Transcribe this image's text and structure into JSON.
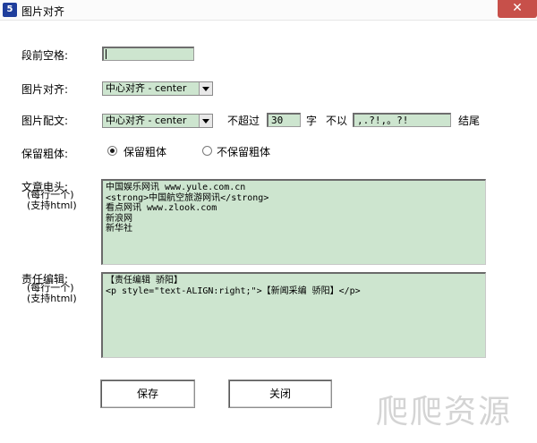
{
  "window": {
    "icon_text": "5",
    "title": "图片对齐",
    "close_glyph": "✕"
  },
  "form": {
    "indent_label": "段前空格:",
    "indent_value": "",
    "image_align_label": "图片对齐:",
    "image_align_value": "中心对齐 - center",
    "caption_label": "图片配文:",
    "caption_align_value": "中心对齐 - center",
    "not_exceed_label": "不超过",
    "max_chars_value": "30",
    "chars_unit": "字",
    "not_end_with_label": "不以",
    "end_chars_value": ",.?!,。?!",
    "ending_label": "结尾",
    "bold_label": "保留粗体:",
    "bold_keep_label": "保留粗体",
    "bold_remove_label": "不保留粗体",
    "bold_selected": "keep",
    "header_label": "文章电头:",
    "header_hint1": "(每行一个)",
    "header_hint2": "(支持html)",
    "header_lines": [
      "中国娱乐网讯 www.yule.com.cn",
      "<strong>中国航空旅游网讯</strong>",
      "看点网讯 www.zlook.com",
      "新浪网",
      "新华社"
    ],
    "editor_label": "责任编辑:",
    "editor_hint1": "(每行一个)",
    "editor_hint2": "(支持html)",
    "editor_lines": [
      "【责任编辑 骄阳】",
      "<p style=\"text-ALIGN:right;\">【新闻采编 骄阳】</p>"
    ]
  },
  "buttons": {
    "save_label": "保存",
    "close_label": "关闭"
  },
  "watermark": {
    "text": "爬爬资源"
  }
}
